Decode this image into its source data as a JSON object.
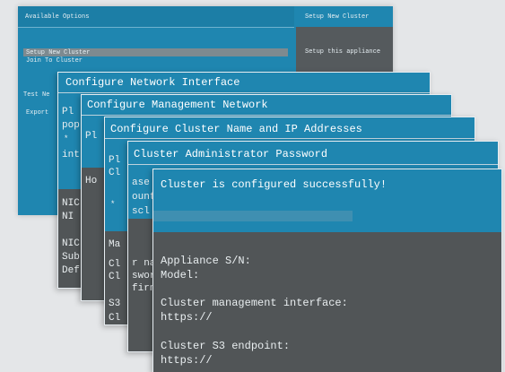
{
  "windows": {
    "w1": {
      "left_title": "Available Options",
      "right_title": "Setup New Cluster",
      "options": [
        "Setup New Cluster",
        "Join To Cluster"
      ],
      "right_text": "Setup this appliance",
      "lower_options": [
        "Test Ne",
        "Export"
      ]
    },
    "w2": {
      "title": "Configure Network Interface",
      "lines": [
        "Pl",
        "pop",
        "*",
        "int"
      ],
      "bottom_lines": [
        "NIC",
        "NI",
        "NIC",
        "Sub",
        "Def"
      ]
    },
    "w3": {
      "title": "Configure Management Network",
      "lines": [
        "Pl"
      ],
      "bottom_lines": [
        "Ho"
      ]
    },
    "w4": {
      "title": "Configure Cluster Name and IP Addresses",
      "lines": [
        "Pl",
        "Cl",
        "*"
      ],
      "bottom_lines": [
        "Ma",
        "Cl",
        "Cl",
        "S3",
        "Cl"
      ]
    },
    "w5": {
      "title": "Cluster Administrator Password",
      "lines": [
        "ase",
        "ount",
        "scl"
      ],
      "bottom_lines": [
        "r na",
        "swor",
        "firn"
      ]
    },
    "w6": {
      "title": "Cluster is configured successfully!",
      "sn_label": "Appliance S/N:",
      "model_label": "Model:",
      "mgmt_label": "Cluster management interface:",
      "mgmt_url": "https://",
      "s3_label": "Cluster S3 endpoint:",
      "s3_url": "https://"
    }
  }
}
